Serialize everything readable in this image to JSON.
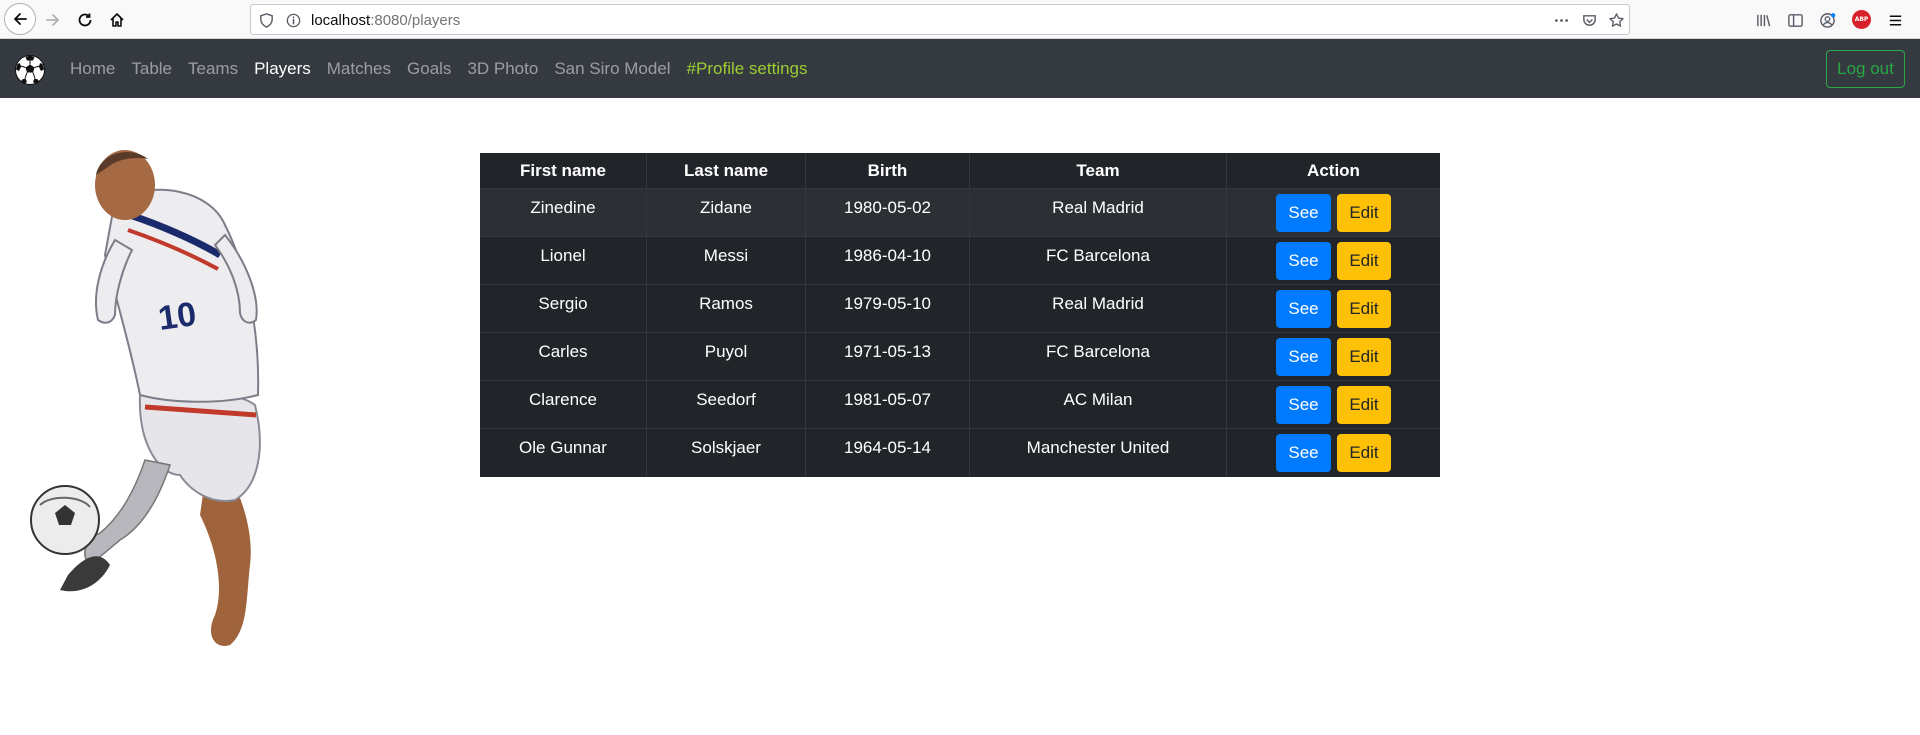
{
  "browser": {
    "url_host": "localhost",
    "url_path": ":8080/players"
  },
  "navbar": {
    "links": [
      {
        "label": "Home"
      },
      {
        "label": "Table"
      },
      {
        "label": "Teams"
      },
      {
        "label": "Players"
      },
      {
        "label": "Matches"
      },
      {
        "label": "Goals"
      },
      {
        "label": "3D Photo"
      },
      {
        "label": "San Siro Model"
      },
      {
        "label": "#Profile settings"
      }
    ],
    "active": "Players",
    "logout_label": "Log out"
  },
  "table": {
    "headers": [
      "First name",
      "Last name",
      "Birth",
      "Team",
      "Action"
    ],
    "rows": [
      {
        "first": "Zinedine",
        "last": "Zidane",
        "birth": "1980-05-02",
        "team": "Real Madrid"
      },
      {
        "first": "Lionel",
        "last": "Messi",
        "birth": "1986-04-10",
        "team": "FC Barcelona"
      },
      {
        "first": "Sergio",
        "last": "Ramos",
        "birth": "1979-05-10",
        "team": "Real Madrid"
      },
      {
        "first": "Carles",
        "last": "Puyol",
        "birth": "1971-05-13",
        "team": "FC Barcelona"
      },
      {
        "first": "Clarence",
        "last": "Seedorf",
        "birth": "1981-05-07",
        "team": "AC Milan"
      },
      {
        "first": "Ole Gunnar",
        "last": "Solskjaer",
        "birth": "1964-05-14",
        "team": "Manchester United"
      }
    ],
    "see_label": "See",
    "edit_label": "Edit"
  },
  "colors": {
    "navbar": "#343a40",
    "table_bg": "#212529",
    "see_button": "#007bff",
    "edit_button": "#ffc107",
    "logout": "#28a745",
    "profile_link": "#9acd32"
  },
  "icons": {
    "browser": [
      "back-arrow-icon",
      "forward-arrow-icon",
      "reload-icon",
      "home-icon",
      "shield-icon",
      "info-icon",
      "more-icon",
      "pocket-icon",
      "bookmark-star-icon",
      "library-icon",
      "sidebar-icon",
      "account-icon",
      "adblock-icon",
      "menu-icon"
    ],
    "brand": "soccer-ball-icon"
  }
}
